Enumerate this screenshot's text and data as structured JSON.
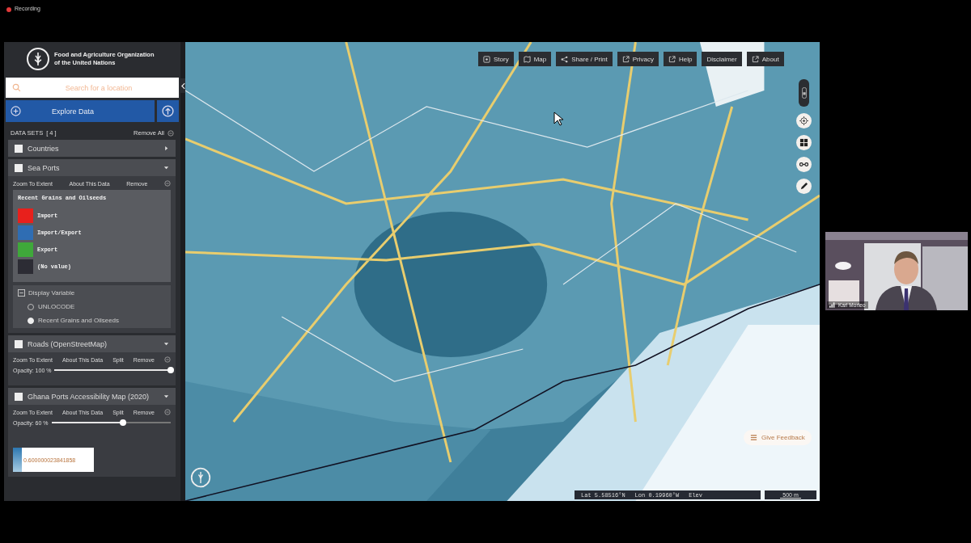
{
  "recording": {
    "label": "Recording"
  },
  "org": {
    "name": "Food and Agriculture Organization of the United Nations"
  },
  "search": {
    "placeholder": "Search for a location"
  },
  "explore_button": {
    "label": "Explore Data"
  },
  "datasets": {
    "title": "DATA SETS",
    "count": "[ 4 ]",
    "remove_all": "Remove All"
  },
  "layers": [
    {
      "name": "Countries",
      "checked": false,
      "expanded": false
    },
    {
      "name": "Sea Ports",
      "checked": false,
      "expanded": true,
      "actions": [
        "Zoom To Extent",
        "About This Data",
        "Remove"
      ],
      "legend": {
        "title": "Recent Grains and Oilseeds",
        "items": [
          {
            "label": "Import",
            "color": "#e8201c"
          },
          {
            "label": "Import/Export",
            "color": "#2f6db3"
          },
          {
            "label": "Export",
            "color": "#3fa83a"
          },
          {
            "label": "(No value)",
            "color": "#2c2c34"
          }
        ]
      },
      "display_variable": {
        "title": "Display Variable",
        "options": [
          {
            "label": "UNLOCODE",
            "selected": false
          },
          {
            "label": "Recent Grains and Oilseeds",
            "selected": true
          }
        ]
      }
    },
    {
      "name": "Roads (OpenStreetMap)",
      "checked": false,
      "expanded": true,
      "actions": [
        "Zoom To Extent",
        "About This Data",
        "Split",
        "Remove"
      ],
      "opacity": {
        "label": "Opacity: 100 %",
        "level": 1
      }
    },
    {
      "name": "Ghana Ports Accessibility Map (2020)",
      "checked": false,
      "expanded": true,
      "actions": [
        "Zoom To Extent",
        "About This Data",
        "Split",
        "Remove"
      ],
      "opacity": {
        "label": "Opacity: 60 %",
        "level": 0.6
      },
      "gradient_legend": {
        "value": "0.600000023841858"
      }
    }
  ],
  "toolbar": [
    {
      "label": "Story",
      "kind": "story"
    },
    {
      "label": "Map",
      "kind": "map"
    },
    {
      "label": "Share / Print",
      "kind": "share"
    },
    {
      "label": "Privacy",
      "kind": "external"
    },
    {
      "label": "Help",
      "kind": "external"
    },
    {
      "label": "Disclaimer",
      "kind": "plain"
    },
    {
      "label": "About",
      "kind": "external"
    }
  ],
  "feedback": {
    "label": "Give Feedback"
  },
  "status": {
    "lat": "Lat 5.58516°N",
    "lon": "Lon 0.19960°W",
    "elev": "Elev",
    "scale": "500 m"
  },
  "participant": {
    "name": "Karl Morteo"
  }
}
